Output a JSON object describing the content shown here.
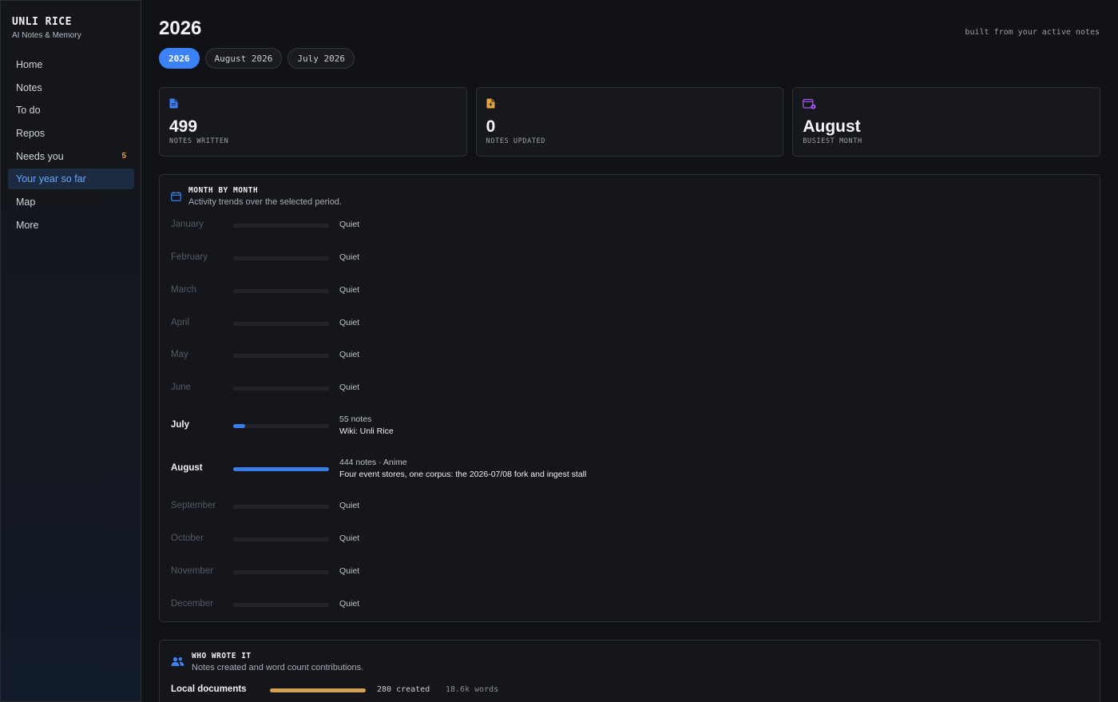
{
  "app": {
    "title": "UNLI RICE",
    "subtitle": "AI Notes & Memory"
  },
  "sidebar": {
    "items": [
      {
        "label": "Home",
        "badge": ""
      },
      {
        "label": "Notes",
        "badge": ""
      },
      {
        "label": "To do",
        "badge": ""
      },
      {
        "label": "Repos",
        "badge": ""
      },
      {
        "label": "Needs you",
        "badge": "5"
      },
      {
        "label": "Your year so far",
        "badge": "",
        "active": true
      },
      {
        "label": "Map",
        "badge": ""
      },
      {
        "label": "More",
        "badge": ""
      }
    ]
  },
  "header": {
    "title": "2026",
    "note": "built from your active notes",
    "tabs": [
      {
        "label": "2026",
        "active": true
      },
      {
        "label": "August 2026",
        "active": false
      },
      {
        "label": "July 2026",
        "active": false
      }
    ]
  },
  "stats": [
    {
      "icon": "document-icon",
      "value": "499",
      "label": "NOTES WRITTEN",
      "color": "#3b82f6"
    },
    {
      "icon": "document-edit-icon",
      "value": "0",
      "label": "NOTES UPDATED",
      "color": "#e2a33d"
    },
    {
      "icon": "calendar-star-icon",
      "value": "August",
      "label": "BUSIEST MONTH",
      "color": "#a855f7"
    }
  ],
  "months_panel": {
    "title": "MONTH BY MONTH",
    "subtitle": "Activity trends over the selected period.",
    "months": [
      {
        "name": "January",
        "fill": 0,
        "line1": "Quiet",
        "line2": ""
      },
      {
        "name": "February",
        "fill": 0,
        "line1": "Quiet",
        "line2": ""
      },
      {
        "name": "March",
        "fill": 0,
        "line1": "Quiet",
        "line2": ""
      },
      {
        "name": "April",
        "fill": 0,
        "line1": "Quiet",
        "line2": ""
      },
      {
        "name": "May",
        "fill": 0,
        "line1": "Quiet",
        "line2": ""
      },
      {
        "name": "June",
        "fill": 0,
        "line1": "Quiet",
        "line2": ""
      },
      {
        "name": "July",
        "fill": 0.124,
        "line1": "55 notes",
        "line2": "Wiki: Unli Rice"
      },
      {
        "name": "August",
        "fill": 1.0,
        "line1": "444 notes · Anime",
        "line2": "Four event stores, one corpus: the 2026-07/08 fork and ingest stall"
      },
      {
        "name": "September",
        "fill": 0,
        "line1": "Quiet",
        "line2": ""
      },
      {
        "name": "October",
        "fill": 0,
        "line1": "Quiet",
        "line2": ""
      },
      {
        "name": "November",
        "fill": 0,
        "line1": "Quiet",
        "line2": ""
      },
      {
        "name": "December",
        "fill": 0,
        "line1": "Quiet",
        "line2": ""
      }
    ]
  },
  "authors_panel": {
    "title": "WHO WROTE IT",
    "subtitle": "Notes created and word count contributions.",
    "rows": [
      {
        "name": "Local documents",
        "fill": 1.0,
        "created": "280 created",
        "words": "18.6k words"
      }
    ]
  },
  "colors": {
    "accent": "#3b82f6",
    "warning": "#e2a33d",
    "purple": "#a855f7",
    "author_bar": "#d2a152"
  }
}
